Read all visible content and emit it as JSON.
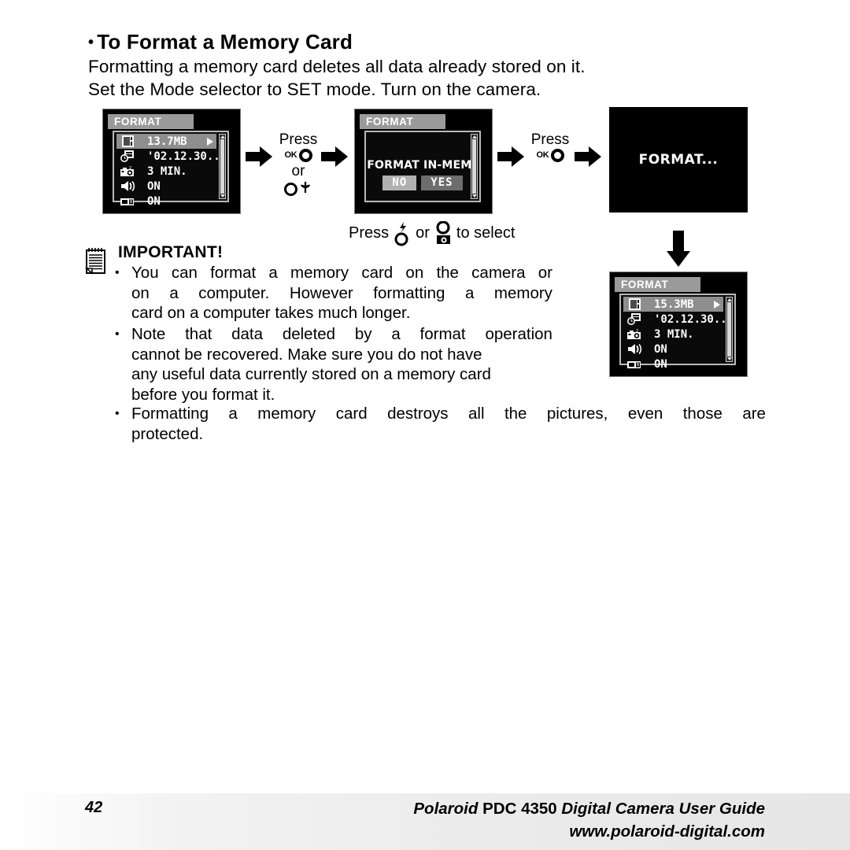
{
  "heading": {
    "bullet": "•",
    "title": "To Format a Memory Card"
  },
  "intro": {
    "line1": "Formatting a memory card deletes all data already stored on it.",
    "line2": "Set the Mode selector to SET mode. Turn on the camera."
  },
  "screens": {
    "menu_before": {
      "title": "FORMAT",
      "rows": [
        {
          "icon": "memory-card-icon",
          "label": "13.7MB",
          "selected": true,
          "caret": true
        },
        {
          "icon": "date-clock-icon",
          "label": "'02.12.30...",
          "selected": false,
          "caret": false
        },
        {
          "icon": "auto-off-camera-icon",
          "label": "3  MIN.",
          "selected": false,
          "caret": false
        },
        {
          "icon": "speaker-beep-icon",
          "label": "ON",
          "selected": false,
          "caret": false
        },
        {
          "icon": "lcd-display-icon",
          "label": "ON",
          "selected": false,
          "caret": false
        }
      ]
    },
    "confirm": {
      "title": "FORMAT",
      "question": "FORMAT IN-MEM?",
      "no_label": "NO",
      "yes_label": "YES"
    },
    "busy": {
      "text": "FORMAT..."
    },
    "menu_after": {
      "title": "FORMAT",
      "rows": [
        {
          "icon": "memory-card-icon",
          "label": "15.3MB",
          "selected": true,
          "caret": true
        },
        {
          "icon": "date-clock-icon",
          "label": "'02.12.30...",
          "selected": false,
          "caret": false
        },
        {
          "icon": "auto-off-camera-icon",
          "label": "3  MIN.",
          "selected": false,
          "caret": false
        },
        {
          "icon": "speaker-beep-icon",
          "label": "ON",
          "selected": false,
          "caret": false
        },
        {
          "icon": "lcd-display-icon",
          "label": "ON",
          "selected": false,
          "caret": false
        }
      ]
    }
  },
  "instructions": {
    "press_1": {
      "press_word": "Press",
      "ok_word": "OK",
      "or_word": "or",
      "macro_icon": "macro-flower-button-icon"
    },
    "press_2": {
      "press_word": "Press",
      "ok_word": "OK"
    },
    "select_hint": {
      "press_word": "Press",
      "flash_icon": "flash-button-icon",
      "or_word": "or",
      "display_icon": "display-button-icon",
      "tail_word": "to select"
    }
  },
  "important": {
    "icon": "notepad-icon",
    "title": "IMPORTANT!",
    "bullets": [
      {
        "marker": "•",
        "lines": [
          {
            "justified": true,
            "words": [
              "You",
              "can",
              "format",
              "a",
              "memory",
              "card",
              "on",
              "the",
              "camera",
              "or"
            ]
          },
          {
            "justified": true,
            "words": [
              "on",
              "a",
              "computer.",
              "However",
              "formatting",
              "a",
              "memory"
            ]
          },
          {
            "justified": false,
            "text": "card on a computer takes much longer."
          }
        ]
      },
      {
        "marker": "•",
        "lines": [
          {
            "justified": true,
            "words": [
              "Note",
              "that",
              "data",
              "deleted",
              "by",
              "a",
              "format",
              "operation"
            ]
          },
          {
            "justified": false,
            "text": "cannot be recovered. Make sure you do not have"
          },
          {
            "justified": false,
            "text": "any useful data currently stored on a memory card"
          },
          {
            "justified": false,
            "text": "before you format it."
          }
        ]
      },
      {
        "marker": "•",
        "lines": [
          {
            "justified": true,
            "words": [
              "Formatting",
              "a",
              "memory",
              "card",
              "destroys",
              "all",
              "the",
              "pictures,",
              "even",
              "those",
              "are"
            ]
          },
          {
            "justified": false,
            "text": "protected."
          }
        ]
      }
    ]
  },
  "footer": {
    "page_number": "42",
    "title_brand": "Polaroid",
    "title_model": " PDC 4350 ",
    "title_rest": "Digital Camera User Guide",
    "url": "www.polaroid-digital.com"
  },
  "colors": {
    "lcd_background": "#000000",
    "lcd_titlebar": "#9a9a9a",
    "lcd_selected_row": "#8e8e8e",
    "button_no": "#b0b0b0",
    "button_yes": "#6d6d6d",
    "footer_band": "#ebebeb"
  }
}
